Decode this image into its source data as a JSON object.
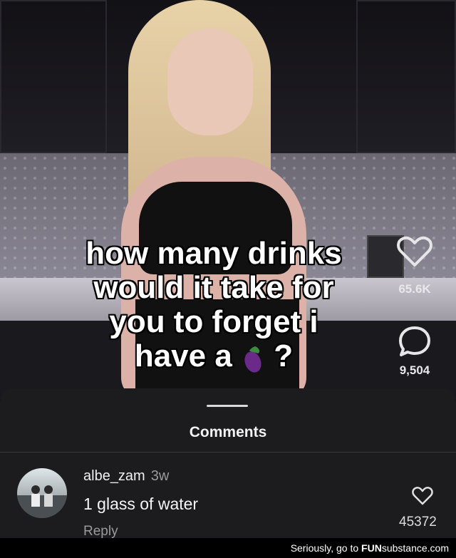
{
  "video": {
    "caption": {
      "line1": "how many drinks",
      "line2": "would it take for",
      "line3": "you to forget i",
      "line4": "have a",
      "line4_end": "?"
    },
    "likes_count": "65.6K",
    "comments_count": "9,504",
    "icons": {
      "like": "heart-outline-icon",
      "comment": "speech-bubble-icon",
      "inline_emoji": "eggplant-emoji-icon"
    }
  },
  "comments_panel": {
    "title": "Comments",
    "comments": [
      {
        "username": "albe_zam",
        "time": "3w",
        "text": "1 glass of water",
        "reply_label": "Reply",
        "likes": "45372"
      }
    ]
  },
  "watermark": {
    "prefix": "Seriously, go to ",
    "brand_bold": "FUN",
    "brand_rest": "substance.com"
  },
  "colors": {
    "sheet_bg": "#1c1c1e",
    "muted_text": "#9a9a9d",
    "primary_text": "#f2f2f2"
  }
}
